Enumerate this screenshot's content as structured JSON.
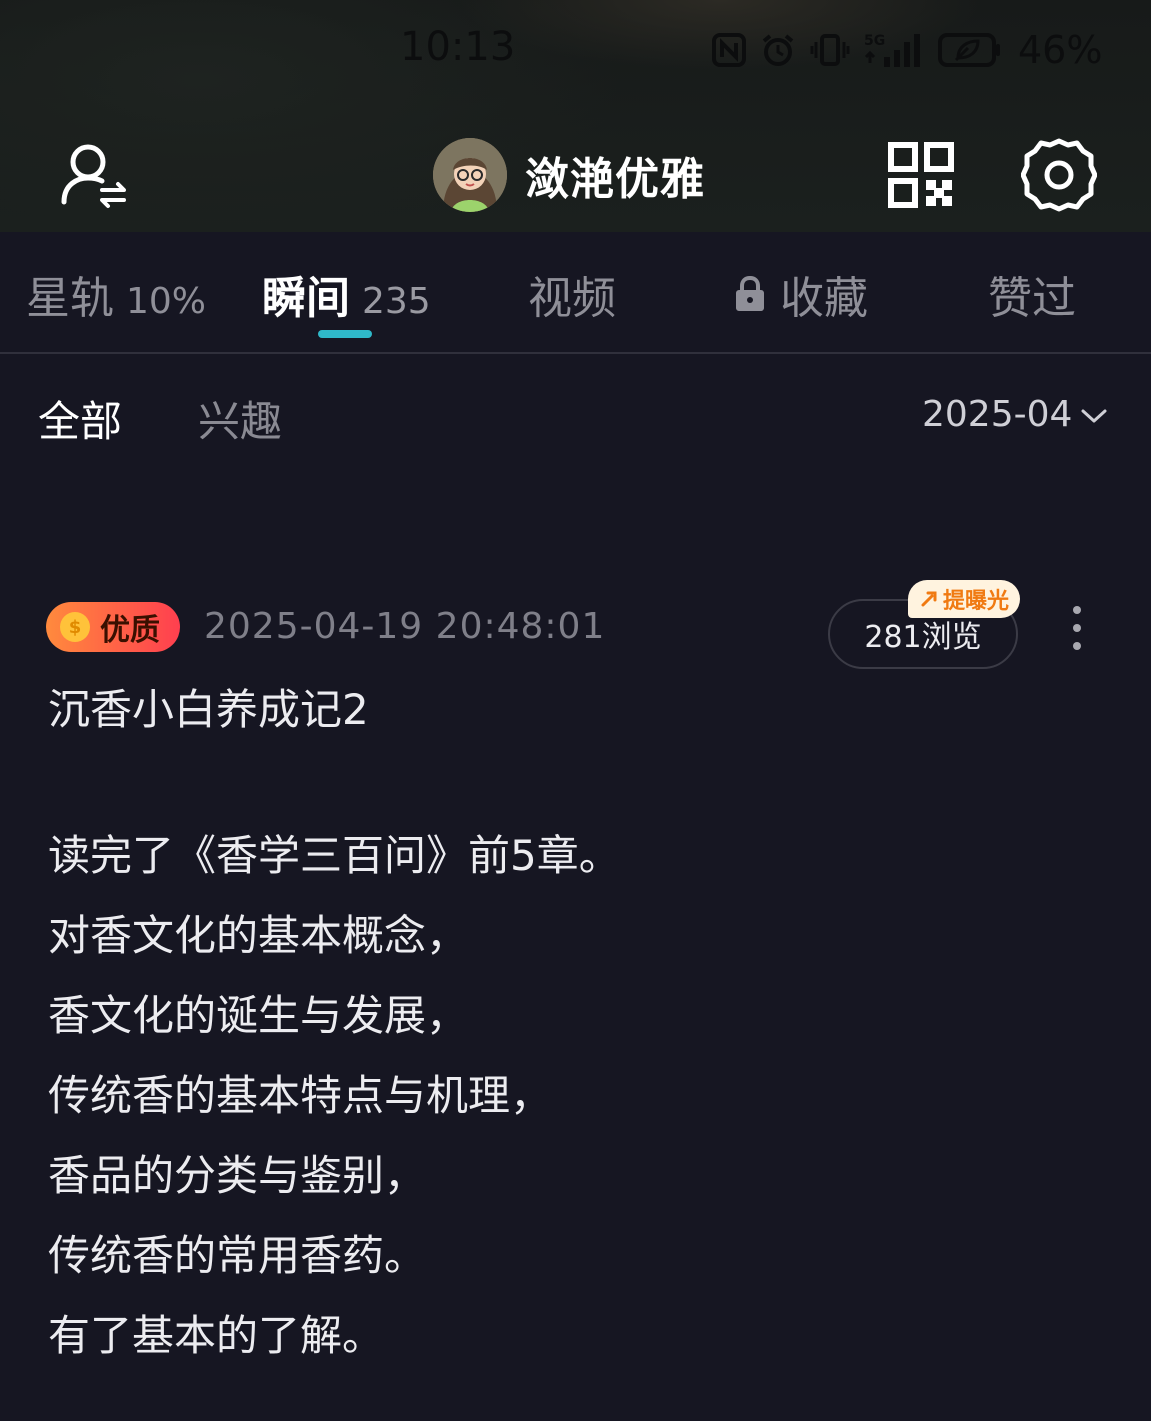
{
  "status_bar": {
    "time": "10:13",
    "network": "5G",
    "battery": "46%",
    "icons": [
      "nfc-icon",
      "alarm-icon",
      "vibrate-icon",
      "signal-icon",
      "battery-icon"
    ]
  },
  "header": {
    "username": "潋滟优雅",
    "icons": [
      "switch-account-icon",
      "qr-code-icon",
      "settings-icon"
    ]
  },
  "tabs": [
    {
      "label": "星轨",
      "count": "10%"
    },
    {
      "label": "瞬间",
      "count": "235",
      "active": true
    },
    {
      "label": "视频",
      "count": ""
    },
    {
      "label": "收藏",
      "count": "",
      "locked": true
    },
    {
      "label": "赞过",
      "count": ""
    }
  ],
  "filters": {
    "all": "全部",
    "interest": "兴趣",
    "month": "2025-04"
  },
  "post": {
    "badge": "优质",
    "coin_symbol": "$",
    "timestamp": "2025-04-19 20:48:01",
    "views": "281浏览",
    "boost": "提曝光",
    "title": "沉香小白养成记2",
    "lines": [
      "读完了《香学三百问》前5章。",
      "对香文化的基本概念，",
      "香文化的诞生与发展，",
      "传统香的基本特点与机理，",
      "香品的分类与鉴别，",
      "传统香的常用香药。",
      "有了基本的了解。"
    ]
  },
  "colors": {
    "background": "#161622",
    "accent": "#2fb8c9",
    "badge_start": "#ff8a3d",
    "badge_end": "#ff3f4f",
    "boost_text": "#f07a12"
  }
}
